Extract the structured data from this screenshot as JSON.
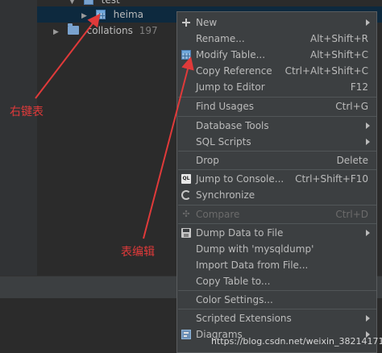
{
  "tree": {
    "db_name": "test",
    "table_name": "heima",
    "folder_name": "collations",
    "folder_count": "197"
  },
  "menu": {
    "items": [
      {
        "label": "New",
        "shortcut": "",
        "submenu": true,
        "icon": "plus-icon"
      },
      {
        "label": "Rename...",
        "shortcut": "Alt+Shift+R"
      },
      {
        "label": "Modify Table...",
        "shortcut": "Alt+Shift+C",
        "icon": "table-icon"
      },
      {
        "label": "Copy Reference",
        "shortcut": "Ctrl+Alt+Shift+C"
      },
      {
        "label": "Jump to Editor",
        "shortcut": "F12"
      },
      {
        "label": "Find Usages",
        "shortcut": "Ctrl+G"
      },
      {
        "label": "Database Tools",
        "shortcut": "",
        "submenu": true
      },
      {
        "label": "SQL Scripts",
        "shortcut": "",
        "submenu": true
      },
      {
        "label": "Drop",
        "shortcut": "Delete"
      },
      {
        "label": "Jump to Console...",
        "shortcut": "Ctrl+Shift+F10",
        "icon": "console-icon"
      },
      {
        "label": "Synchronize",
        "shortcut": "",
        "icon": "sync-icon"
      },
      {
        "label": "Compare",
        "shortcut": "Ctrl+D",
        "disabled": true,
        "icon": "compare-icon"
      },
      {
        "label": "Dump Data to File",
        "shortcut": "",
        "submenu": true,
        "icon": "save-icon"
      },
      {
        "label": "Dump with 'mysqldump'",
        "shortcut": ""
      },
      {
        "label": "Import Data from File...",
        "shortcut": ""
      },
      {
        "label": "Copy Table to...",
        "shortcut": ""
      },
      {
        "label": "Color Settings...",
        "shortcut": ""
      },
      {
        "label": "Scripted Extensions",
        "shortcut": "",
        "submenu": true
      },
      {
        "label": "Diagrams",
        "shortcut": "",
        "submenu": true,
        "icon": "diagram-icon"
      }
    ]
  },
  "annotations": {
    "right_click_table": "右键表",
    "modify_table": "表编辑"
  },
  "watermark": "https://blog.csdn.net/weixin_38214171",
  "colors": {
    "background": "#2b2b2b",
    "menu_background": "#3c3f41",
    "selection": "#0d293e",
    "annotation_red": "#e03a3a",
    "table_icon_blue": "#8fb5d9"
  }
}
